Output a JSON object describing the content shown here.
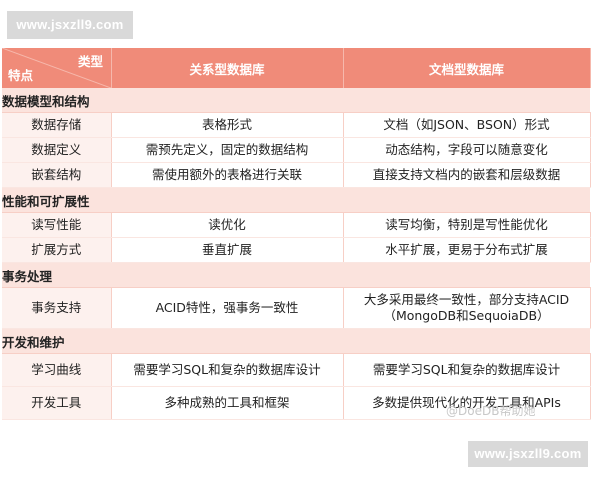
{
  "watermark": {
    "top": "www.jsxzll9.com",
    "bottom": "www.jsxzll9.com",
    "overlay": "@DoeDB帮助她"
  },
  "header": {
    "corner_type": "类型",
    "corner_feature": "特点",
    "col_relational": "关系型数据库",
    "col_document": "文档型数据库"
  },
  "sections": [
    {
      "title": "数据模型和结构",
      "rows": [
        {
          "feature": "数据存储",
          "relational": "表格形式",
          "document": "文档（如JSON、BSON）形式"
        },
        {
          "feature": "数据定义",
          "relational": "需预先定义，固定的数据结构",
          "document": "动态结构，字段可以随意变化"
        },
        {
          "feature": "嵌套结构",
          "relational": "需使用额外的表格进行关联",
          "document": "直接支持文档内的嵌套和层级数据"
        }
      ]
    },
    {
      "title": "性能和可扩展性",
      "rows": [
        {
          "feature": "读写性能",
          "relational": "读优化",
          "document": "读写均衡，特别是写性能优化"
        },
        {
          "feature": "扩展方式",
          "relational": "垂直扩展",
          "document": "水平扩展，更易于分布式扩展"
        }
      ]
    },
    {
      "title": "事务处理",
      "rows": [
        {
          "feature": "事务支持",
          "relational": "ACID特性，强事务一致性",
          "document": "大多采用最终一致性，部分支持ACID（MongoDB和SequoiaDB）"
        }
      ]
    },
    {
      "title": "开发和维护",
      "rows": [
        {
          "feature": "学习曲线",
          "relational": "需要学习SQL和复杂的数据库设计",
          "document": "需要学习SQL和复杂的数据库设计"
        },
        {
          "feature": "开发工具",
          "relational": "多种成熟的工具和框架",
          "document": "多数提供现代化的开发工具和APIs"
        }
      ]
    }
  ]
}
